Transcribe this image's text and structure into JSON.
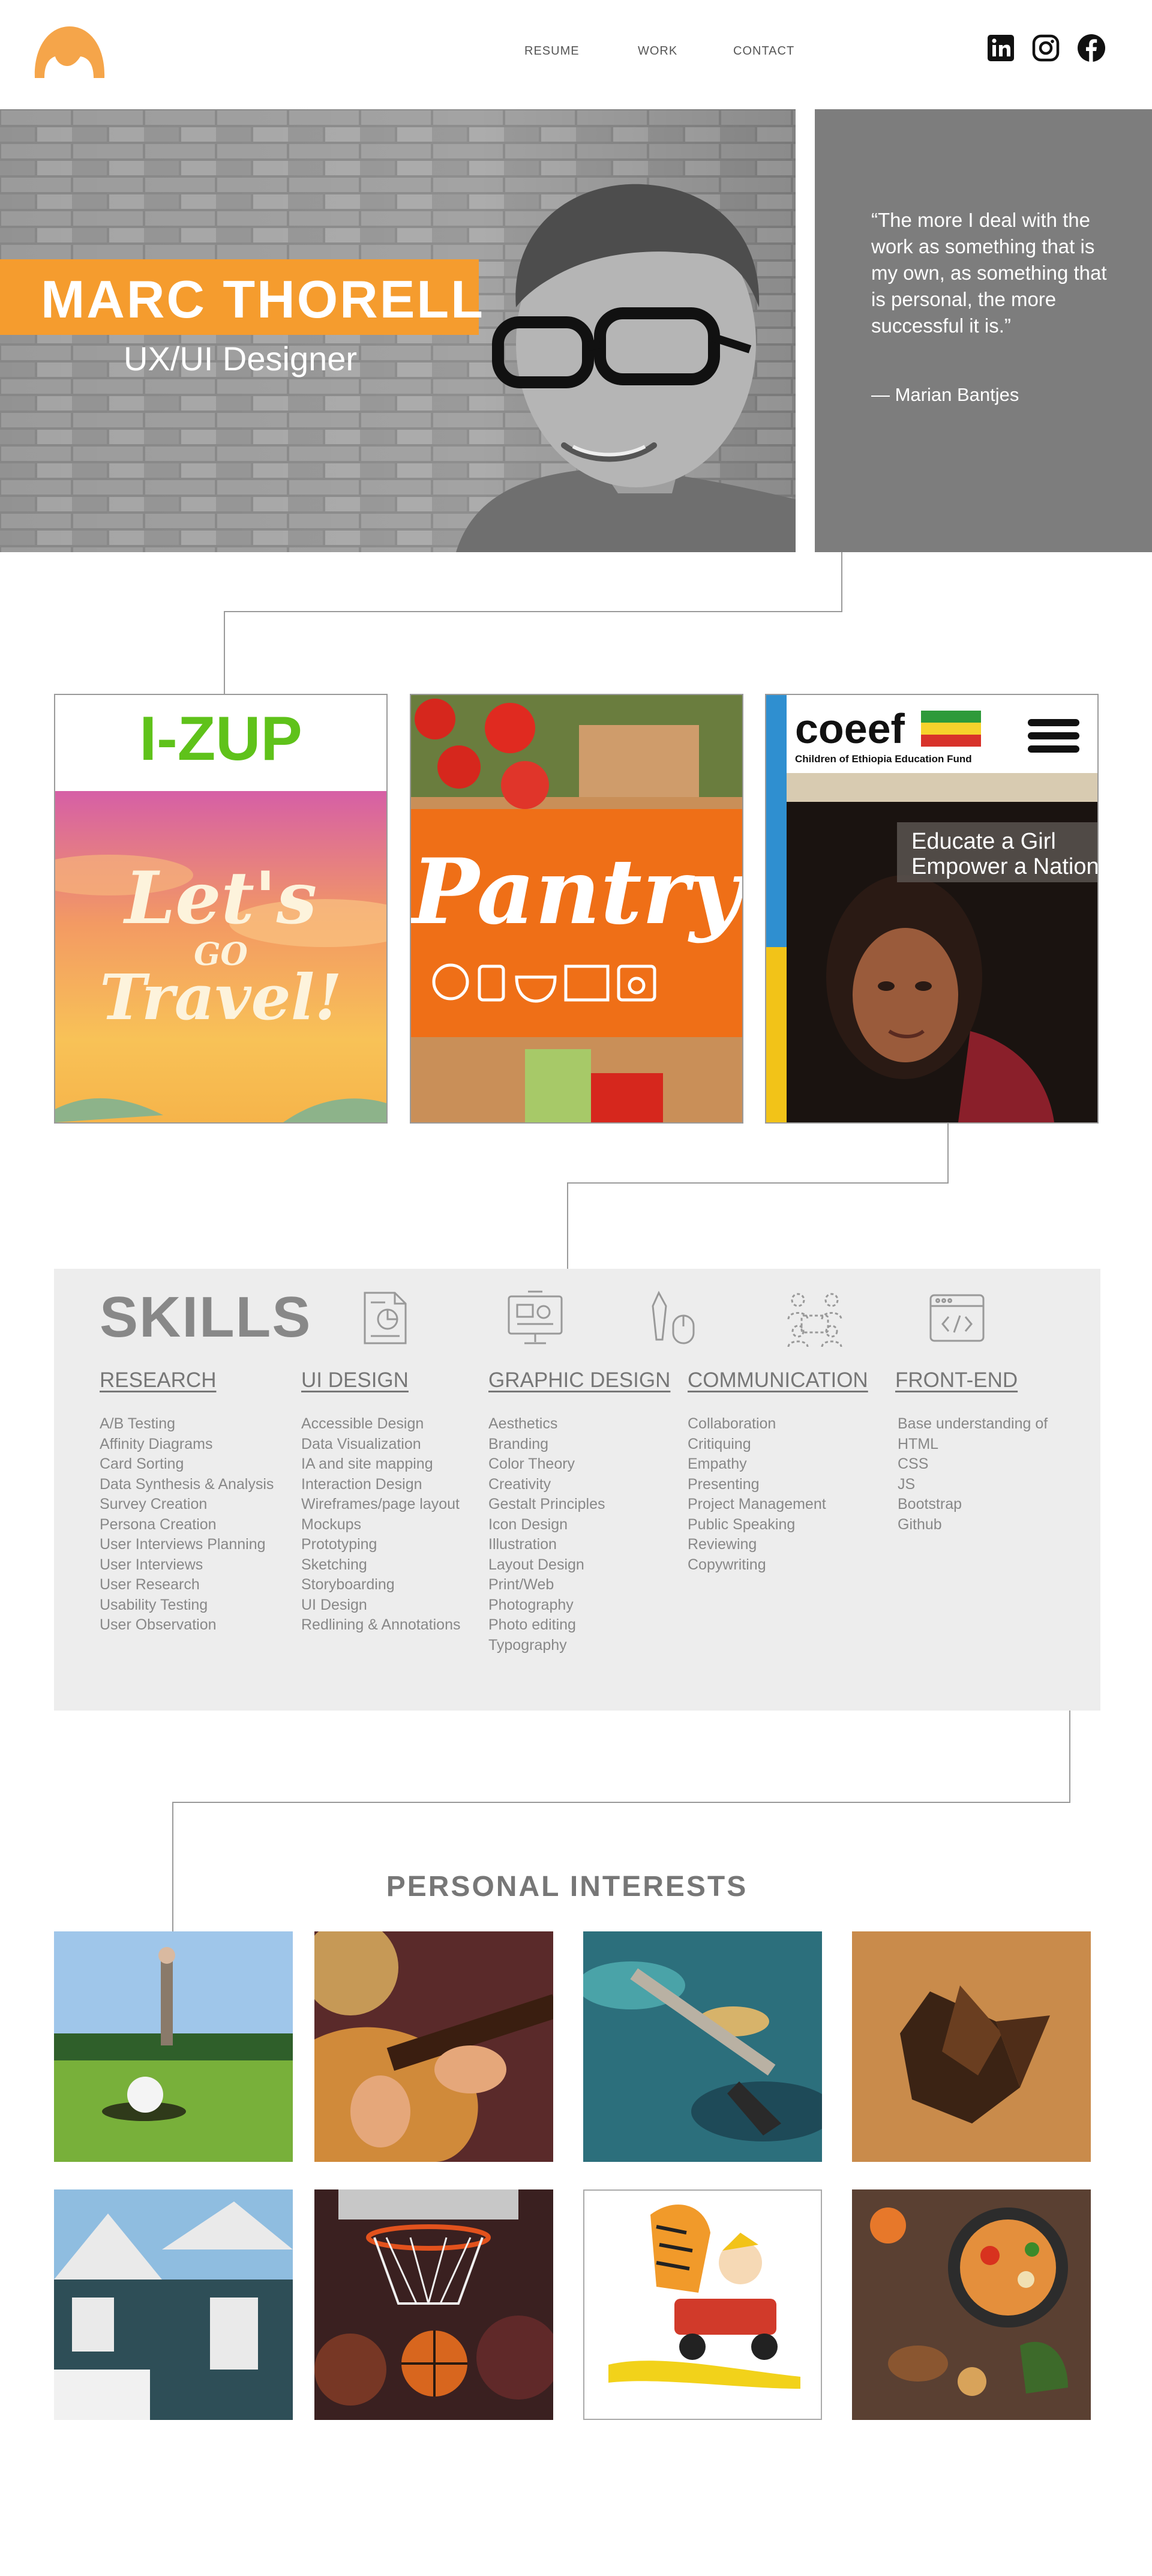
{
  "nav": {
    "resume": "RESUME",
    "work": "WORK",
    "contact": "CONTACT"
  },
  "social": {
    "linkedin": "in",
    "instagram": "instagram-icon",
    "facebook": "f"
  },
  "hero": {
    "name": "MARC THORELL",
    "title": "UX/UI Designer",
    "quote": "“The more I deal with the work as something that is my own, as something that is personal, the more successful it is.”",
    "quote_author": "— Marian Bantjes"
  },
  "work": [
    {
      "brand": "I-ZUP",
      "art_text": [
        "Let's",
        "GO",
        "Travel!"
      ]
    },
    {
      "brand": "Pantry"
    },
    {
      "brand": "coeef",
      "brand_sub": "Children of Ethiopia Education Fund",
      "tagline_1": "Educate a Girl",
      "tagline_2": "Empower a Nation"
    }
  ],
  "skills": {
    "title": "SKILLS",
    "columns": [
      {
        "heading": "RESEARCH",
        "items": [
          "A/B Testing",
          "Affinity Diagrams",
          "Card Sorting",
          "Data Synthesis & Analysis",
          "Survey Creation",
          "Persona Creation",
          "User Interviews Planning",
          "User Interviews",
          "User Research",
          "Usability Testing",
          "User Observation"
        ]
      },
      {
        "heading": "UI DESIGN",
        "items": [
          "Accessible Design",
          "Data Visualization",
          "IA and site mapping",
          "Interaction Design",
          "Wireframes/page layout",
          "Mockups",
          "Prototyping",
          "Sketching",
          "Storyboarding",
          "UI Design",
          "Redlining & Annotations"
        ]
      },
      {
        "heading": "GRAPHIC DESIGN",
        "items": [
          "Aesthetics",
          "Branding",
          "Color Theory",
          "Creativity",
          "Gestalt Principles",
          "Icon Design",
          "Illustration",
          "Layout Design",
          "Print/Web",
          "Photography",
          "Photo editing",
          "Typography"
        ]
      },
      {
        "heading": "COMMUNICATION",
        "items": [
          "Collaboration",
          "Critiquing",
          "Empathy",
          "Presenting",
          "Project Management",
          "Public Speaking",
          "Reviewing",
          "Copywriting"
        ]
      },
      {
        "heading": "FRONT-END",
        "items": [
          "Base understanding of",
          "HTML",
          "CSS",
          "JS",
          "Bootstrap",
          "Github"
        ]
      }
    ]
  },
  "interests": {
    "title": "PERSONAL INTERESTS",
    "items": [
      "golf",
      "guitar",
      "painting",
      "woodworking",
      "home-renovation",
      "basketball",
      "calvin-and-hobbes",
      "cooking"
    ]
  },
  "colors": {
    "accent": "#f59c2e",
    "quote_bg": "#7d7d7d",
    "skills_bg": "#ededed",
    "izup_green": "#5fc21a",
    "pantry_orange": "#ef6f17"
  }
}
